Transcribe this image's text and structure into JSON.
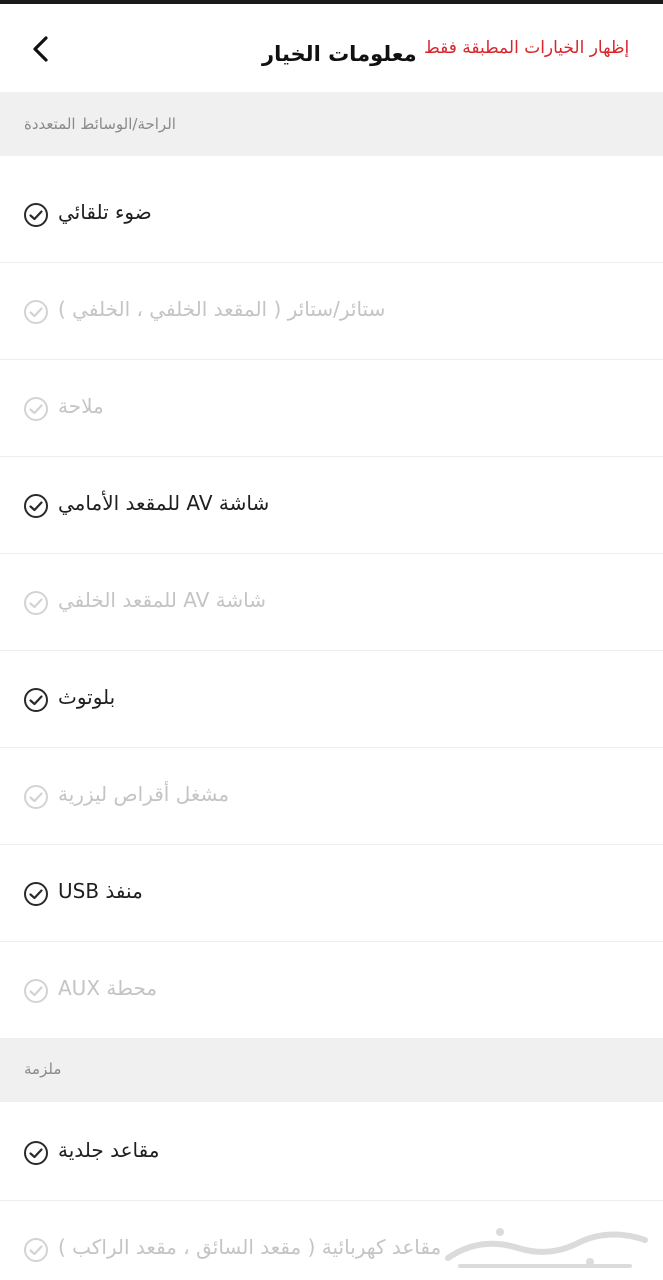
{
  "header": {
    "title": "معلومات الخيار",
    "filter_link": "إظهار الخيارات المطبقة فقط",
    "back_icon": "chevron-left-icon"
  },
  "sections": [
    {
      "title": "الراحة/الوسائط المتعددة",
      "items": [
        {
          "label": "ضوء تلقائي",
          "enabled": true
        },
        {
          "label": "ستائر/ستائر ( المقعد الخلفي ، الخلفي )",
          "enabled": false
        },
        {
          "label": "ملاحة",
          "enabled": false
        },
        {
          "label": "شاشة AV للمقعد الأمامي",
          "enabled": true
        },
        {
          "label": "شاشة AV للمقعد الخلفي",
          "enabled": false
        },
        {
          "label": "بلوتوث",
          "enabled": true
        },
        {
          "label": "مشغل أقراص ليزرية",
          "enabled": false
        },
        {
          "label": "منفذ USB",
          "enabled": true
        },
        {
          "label": "محطة AUX",
          "enabled": false
        }
      ]
    },
    {
      "title": "ملزمة",
      "items": [
        {
          "label": "مقاعد جلدية",
          "enabled": true
        },
        {
          "label": "مقاعد كهربائية ( مقعد السائق ، مقعد الراكب )",
          "enabled": false
        }
      ]
    }
  ],
  "colors": {
    "accent_red": "#d8262d",
    "enabled_text": "#1f1f1f",
    "disabled_text": "#c4c4c4",
    "section_bg": "#f0f0f0"
  },
  "watermark_icon": "haraj-logo-watermark"
}
